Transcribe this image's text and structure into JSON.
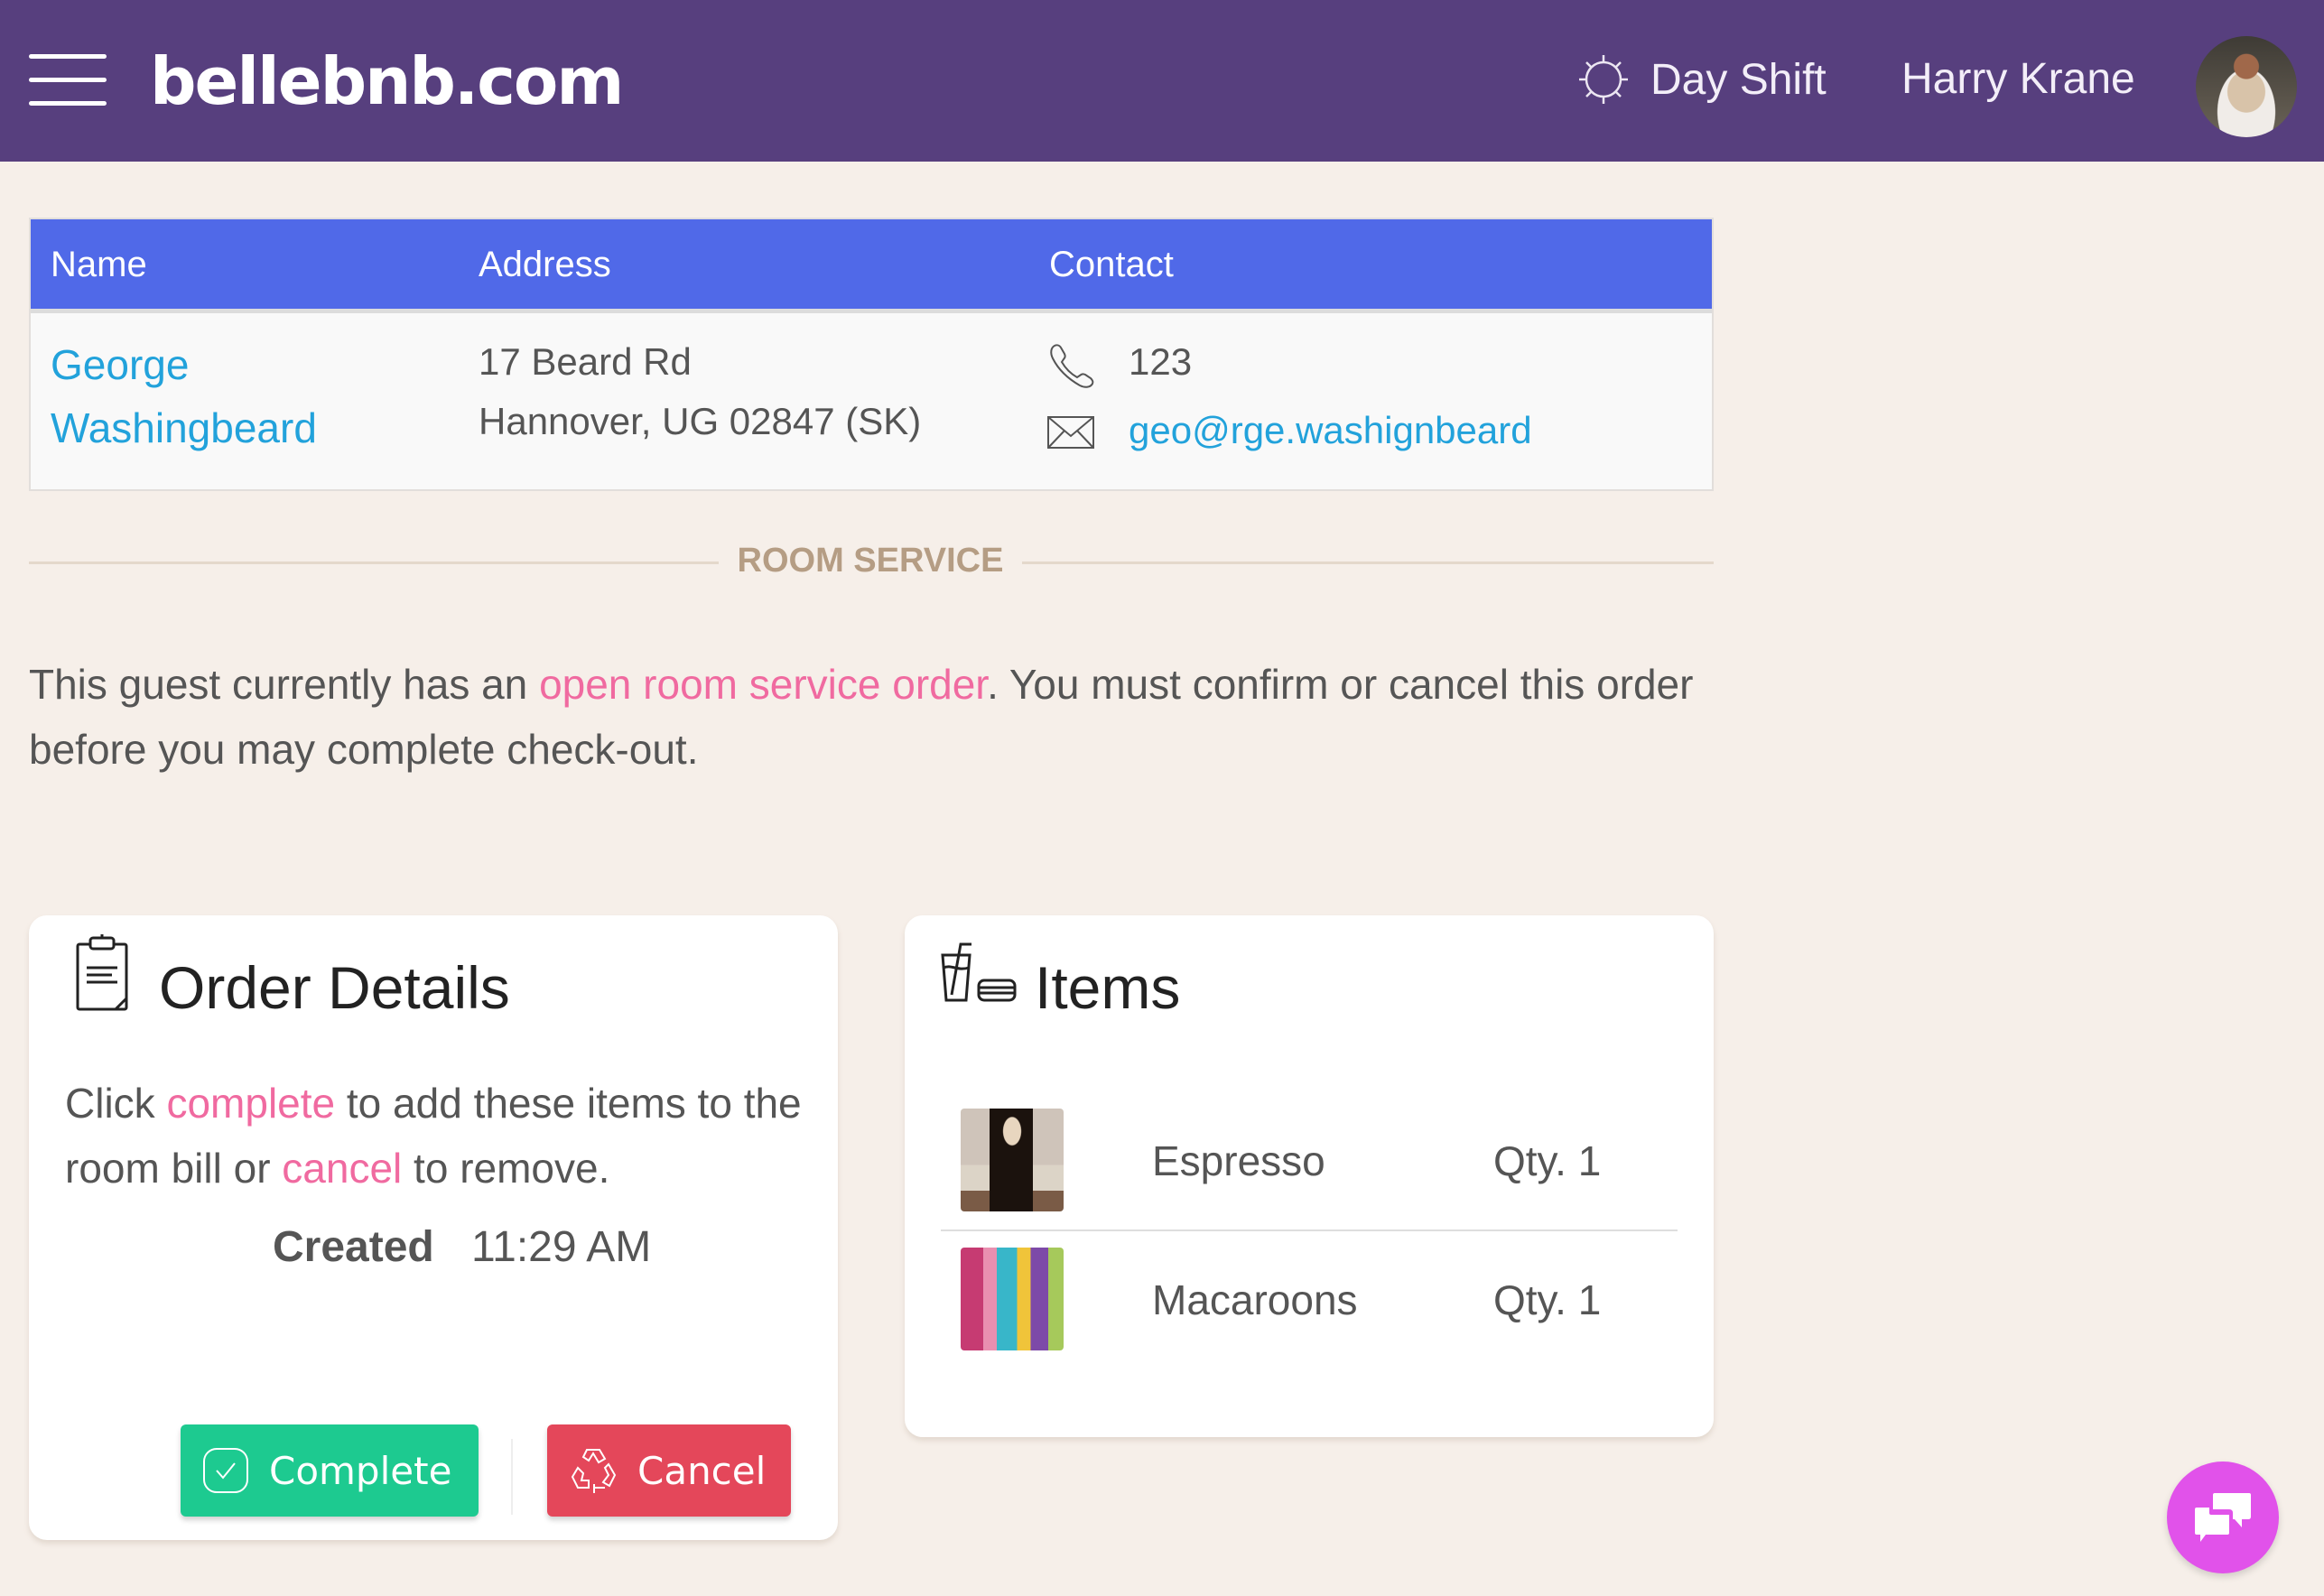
{
  "header": {
    "menu_icon": "hamburger-icon",
    "logo": "bellebnb.com",
    "shift_icon": "sun-icon",
    "shift_label": "Day Shift",
    "user_name": "Harry Krane",
    "avatar_alt": "user-avatar"
  },
  "guest_table": {
    "columns": [
      "Name",
      "Address",
      "Contact"
    ],
    "row": {
      "name_line1": "George",
      "name_line2": "Washingbeard",
      "address_line1": "17 Beard Rd",
      "address_line2": "Hannover, UG 02847 (SK)",
      "phone": "123",
      "email": "geo@rge.washignbeard"
    }
  },
  "section_divider": "ROOM SERVICE",
  "notice": {
    "prefix": "This guest currently has an ",
    "link": "open room service order",
    "suffix": ". You must confirm or cancel this order before you may complete check-out."
  },
  "order_details": {
    "title": "Order Details",
    "icon": "clipboard-icon",
    "desc_prefix": "Click ",
    "desc_link1": "complete",
    "desc_middle": " to add these items to the room bill or ",
    "desc_link2": "cancel",
    "desc_suffix": " to remove.",
    "created_label": "Created",
    "created_value": "11:29 AM",
    "complete_label": "Complete",
    "cancel_label": "Cancel"
  },
  "items": {
    "title": "Items",
    "icon": "food-drink-icon",
    "list": [
      {
        "name": "Espresso",
        "qty": "Qty. 1"
      },
      {
        "name": "Macaroons",
        "qty": "Qty. 1"
      }
    ]
  },
  "colors": {
    "header_bg": "#573f7e",
    "table_header_bg": "#5069e8",
    "link_blue": "#22a2db",
    "link_pink": "#f06aa0",
    "complete_green": "#1dca90",
    "cancel_red": "#e4475a",
    "chat_purple": "#e152ea",
    "page_bg": "#f6efe9"
  }
}
